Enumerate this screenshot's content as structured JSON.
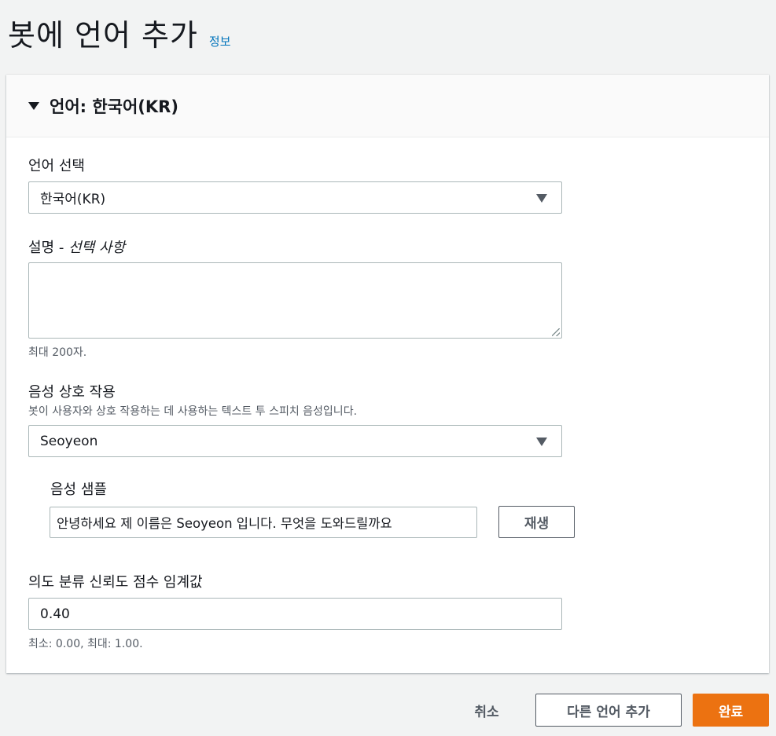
{
  "page": {
    "title": "봇에 언어 추가",
    "info_link": "정보"
  },
  "panel": {
    "title": "언어: 한국어(KR)"
  },
  "language": {
    "label": "언어 선택",
    "selected": "한국어(KR)"
  },
  "description": {
    "label": "설명 - ",
    "label_optional": "선택 사항",
    "value": "",
    "hint": "최대 200자."
  },
  "voice": {
    "label": "음성 상호 작용",
    "description": "봇이 사용자와 상호 작용하는 데 사용하는 텍스트 투 스피치 음성입니다.",
    "selected": "Seoyeon"
  },
  "voice_sample": {
    "label": "음성 샘플",
    "value": "안녕하세요 제 이름은 Seoyeon 입니다. 무엇을 도와드릴까요",
    "play_label": "재생"
  },
  "threshold": {
    "label": "의도 분류 신뢰도 점수 임계값",
    "value": "0.40",
    "hint": "최소: 0.00, 최대: 1.00."
  },
  "footer": {
    "cancel_label": "취소",
    "add_another_label": "다른 언어 추가",
    "done_label": "완료"
  },
  "colors": {
    "primary": "#ec7211",
    "link": "#0073bb"
  }
}
